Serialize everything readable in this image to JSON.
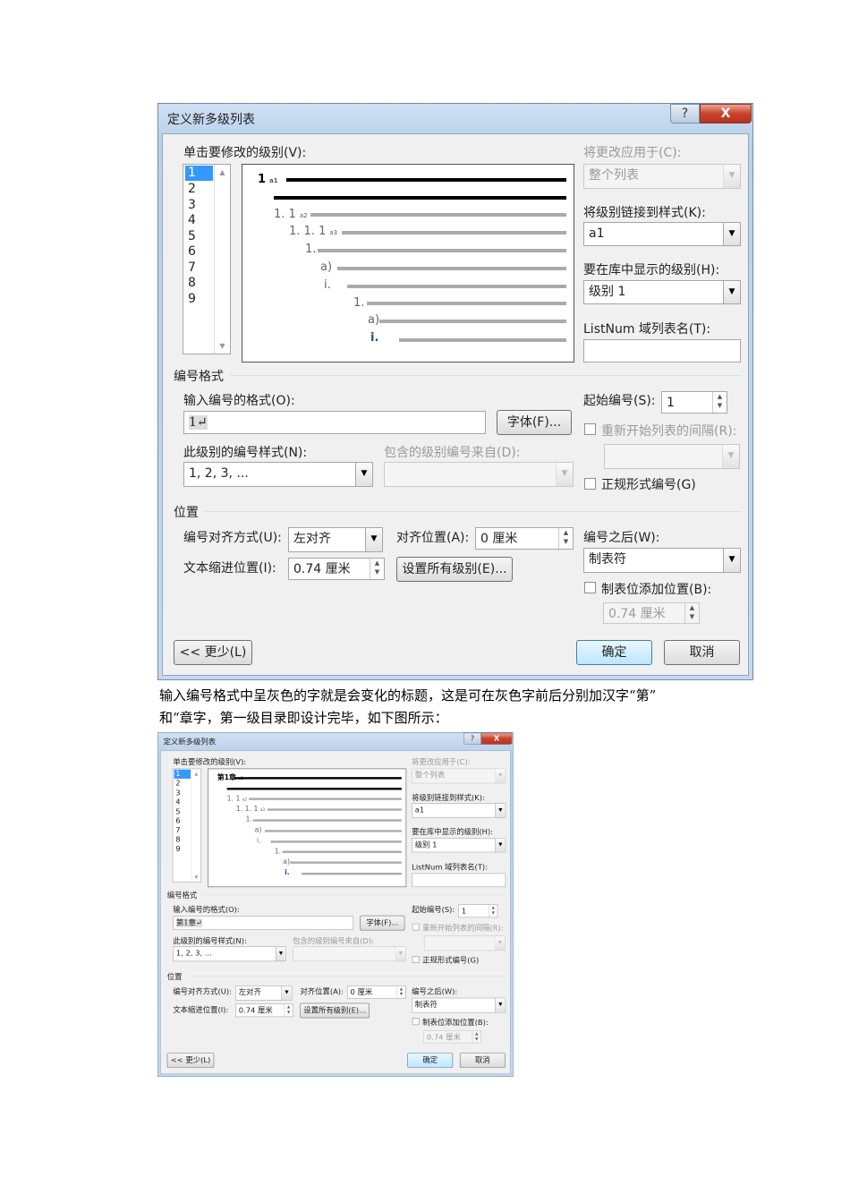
{
  "dialog_labels": {
    "title": "定义新多级列表",
    "help_button": "?",
    "close_button": "X",
    "click_level_label": "单击要修改的级别(V):",
    "levels": [
      "1",
      "2",
      "3",
      "4",
      "5",
      "6",
      "7",
      "8",
      "9"
    ],
    "apply_to_label": "将更改应用于(C):",
    "apply_to_value": "整个列表",
    "link_style_label": "将级别链接到样式(K):",
    "link_style_value": "a1",
    "gallery_level_label": "要在库中显示的级别(H):",
    "gallery_level_value": "级别 1",
    "listnum_label": "ListNum 域列表名(T):",
    "listnum_value": "",
    "number_format_section": "编号格式",
    "enter_format_label": "输入编号的格式(O):",
    "font_button": "字体(F)...",
    "start_at_label": "起始编号(S):",
    "restart_label": "重新开始列表的间隔(R):",
    "number_style_label": "此级别的编号样式(N):",
    "number_style_value": "1, 2, 3, ...",
    "include_level_label": "包含的级别编号来自(D):",
    "legal_label": "正规形式编号(G)",
    "position_section": "位置",
    "alignment_label": "编号对齐方式(U):",
    "alignment_value": "左对齐",
    "aligned_at_label": "对齐位置(A):",
    "aligned_at_value": "0 厘米",
    "indent_label": "文本缩进位置(I):",
    "indent_value": "0.74 厘米",
    "set_all_button": "设置所有级别(E)...",
    "follow_label": "编号之后(W):",
    "follow_value": "制表符",
    "tab_stop_label": "制表位添加位置(B):",
    "tab_stop_value": "0.74 厘米",
    "less_button": "<< 更少(L)",
    "ok_button": "确定",
    "cancel_button": "取消",
    "preview": {
      "sub1": "a1",
      "sub2": "a2",
      "sub3": "a3",
      "l2": "1. 1",
      "l3": "1. 1. 1",
      "l4": "1.",
      "l5": "a)",
      "l6": "i.",
      "l7": "1.",
      "l8": "a)",
      "l9": "i."
    }
  },
  "dialogs": [
    {
      "preview_level1": "1",
      "format_value": "1↵",
      "start_value": "1"
    },
    {
      "preview_level1": "第1章",
      "format_value": "第1章↵",
      "start_value": "1"
    }
  ],
  "paragraph": {
    "line1": "输入编号格式中呈灰色的字就是会变化的标题，这是可在灰色字前后分别加汉字“第”",
    "line2": "和“章字，第一级目录即设计完毕，如下图所示："
  }
}
